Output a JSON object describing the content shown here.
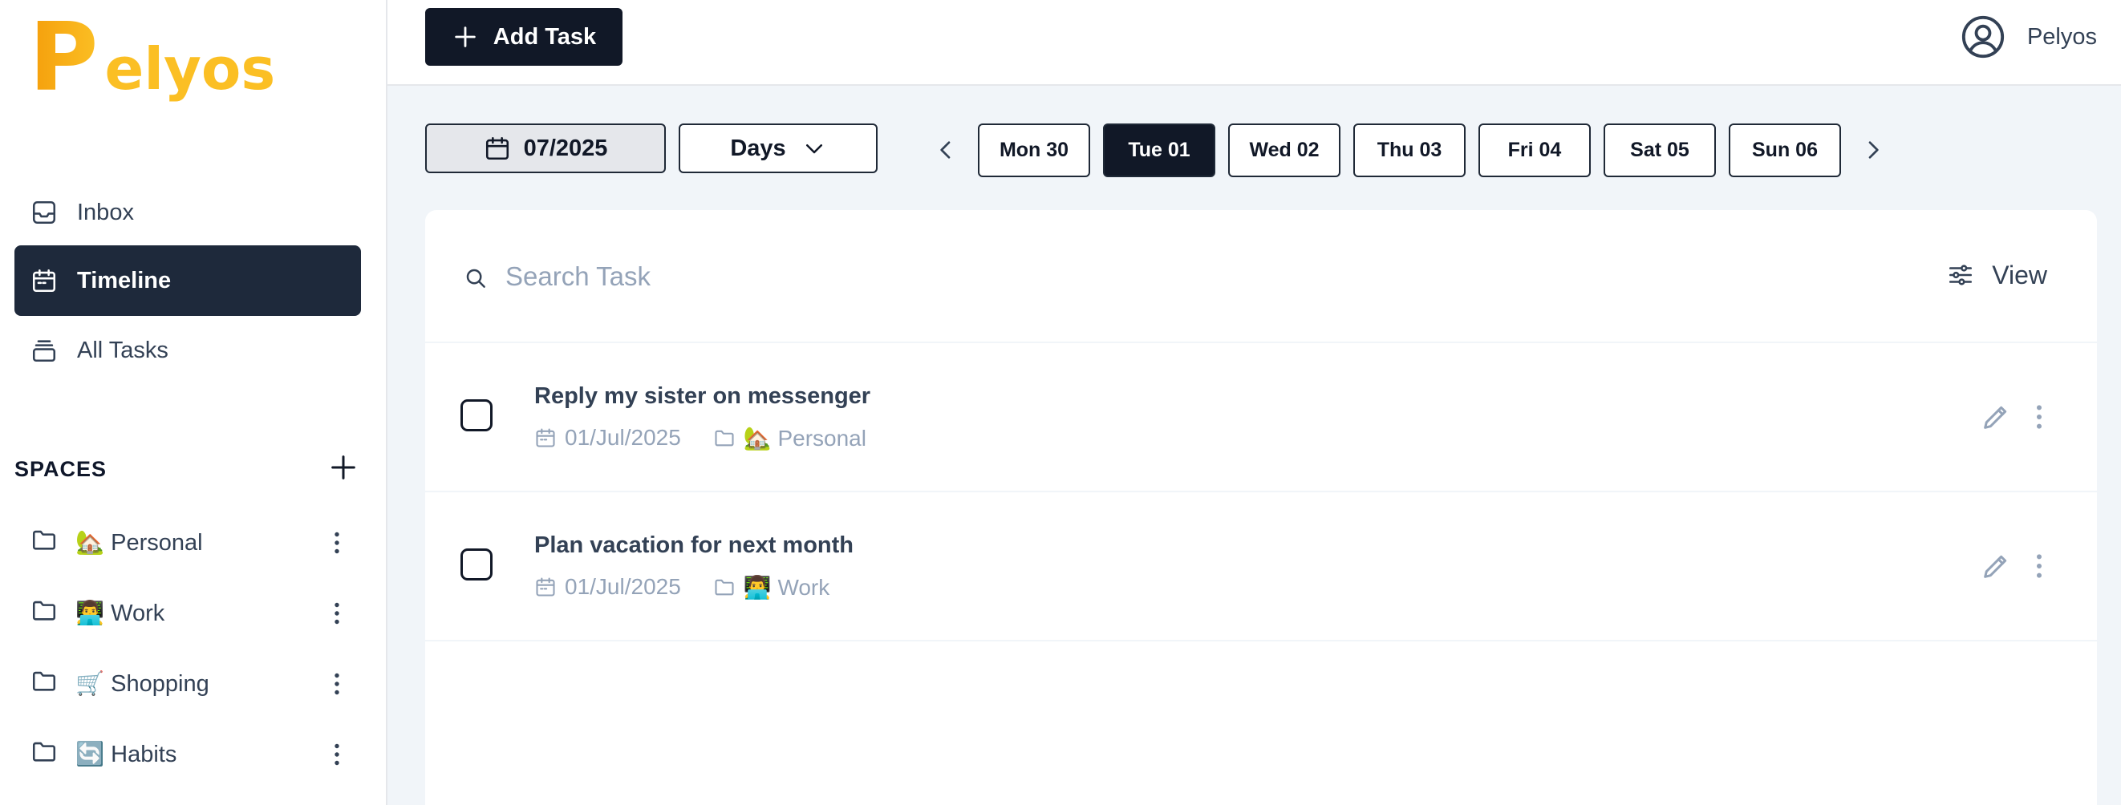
{
  "brand": {
    "logo_letter": "P",
    "logo_rest": "elyos"
  },
  "sidebar": {
    "nav": [
      {
        "label": "Inbox",
        "icon": "inbox-icon"
      },
      {
        "label": "Timeline",
        "icon": "calendar-icon",
        "active": true
      },
      {
        "label": "All Tasks",
        "icon": "stack-icon"
      }
    ],
    "spaces_title": "SPACES",
    "spaces": [
      {
        "label": "🏡 Personal"
      },
      {
        "label": "👨‍💻 Work"
      },
      {
        "label": "🛒 Shopping"
      },
      {
        "label": "🔄 Habits"
      }
    ]
  },
  "topbar": {
    "add_task_label": "Add Task",
    "user_name": "Pelyos"
  },
  "controls": {
    "month": "07/2025",
    "mode": "Days",
    "days": [
      "Mon 30",
      "Tue 01",
      "Wed 02",
      "Thu 03",
      "Fri 04",
      "Sat 05",
      "Sun 06"
    ],
    "selected_day": "Tue 01"
  },
  "search": {
    "placeholder": "Search Task",
    "value": ""
  },
  "view_label": "View",
  "tasks": [
    {
      "title": "Reply my sister on messenger",
      "date": "01/Jul/2025",
      "space": "🏡 Personal"
    },
    {
      "title": "Plan vacation for next month",
      "date": "01/Jul/2025",
      "space": "👨‍💻 Work"
    }
  ],
  "colors": {
    "primary": "#111827",
    "sidebar_active": "#1e293b",
    "brand": "#fbbf24",
    "background": "#f1f5f9",
    "muted_text": "#94a3b8"
  }
}
